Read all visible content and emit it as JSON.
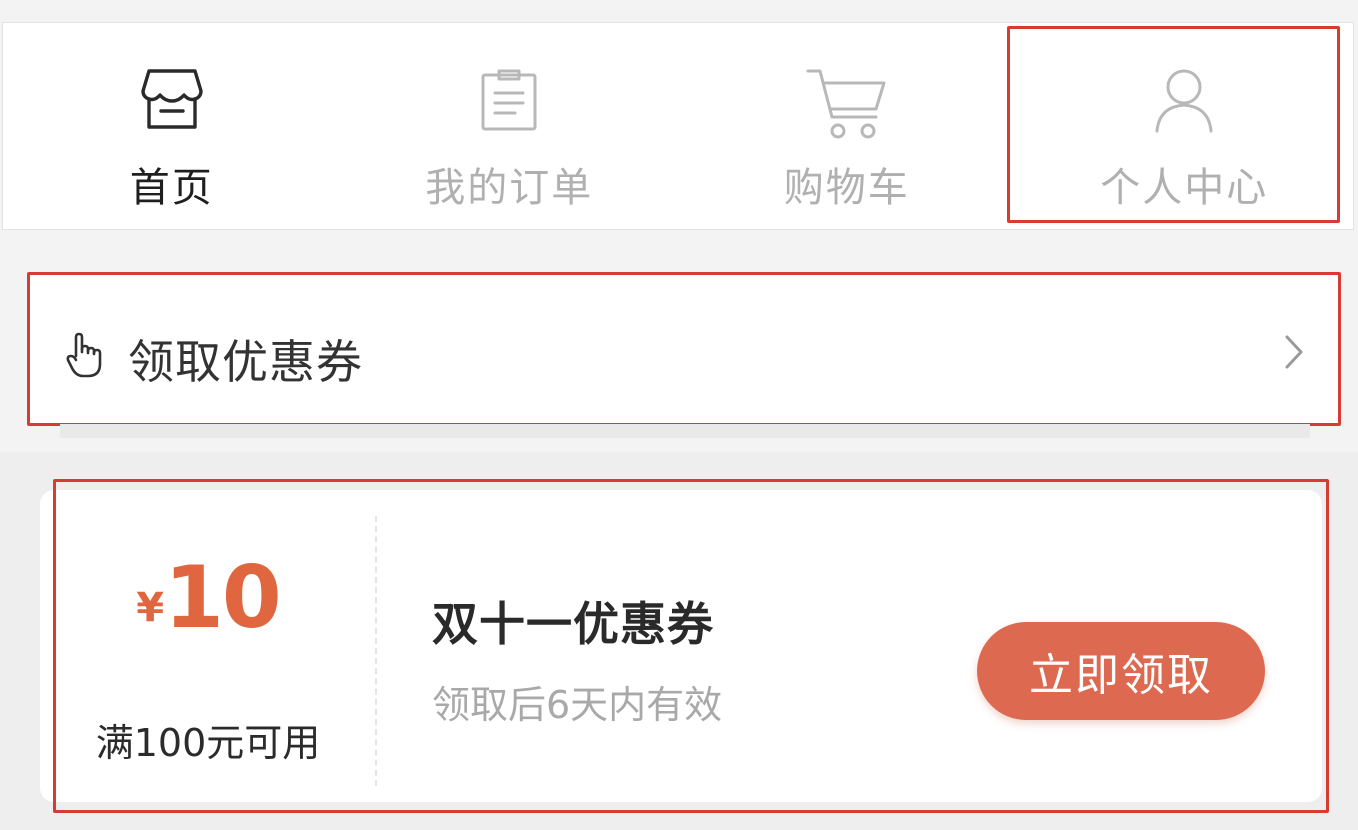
{
  "tabs": [
    {
      "label": "首页",
      "icon": "store-icon",
      "active": true
    },
    {
      "label": "我的订单",
      "icon": "order-list-icon",
      "active": false
    },
    {
      "label": "购物车",
      "icon": "cart-icon",
      "active": false
    },
    {
      "label": "个人中心",
      "icon": "user-icon",
      "active": false
    }
  ],
  "coupon_entry": {
    "icon": "hand-pointer-icon",
    "title": "领取优惠券",
    "arrow": "chevron-right-icon"
  },
  "coupon": {
    "currency": "¥",
    "amount": "10",
    "condition": "满100元可用",
    "name": "双十一优惠券",
    "validity": "领取后6天内有效",
    "claim_label": "立即领取"
  },
  "colors": {
    "highlight": "#d83a34",
    "price": "#e0663f",
    "button": "#dd6a50",
    "tab_active": "#1f1f1f",
    "tab_inactive": "#b0b0b0"
  }
}
